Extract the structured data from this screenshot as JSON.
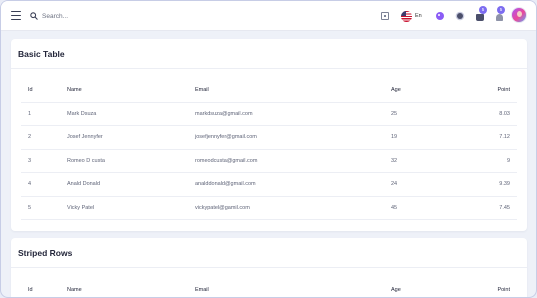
{
  "header": {
    "search_placeholder": "Search...",
    "language": "En",
    "cart_count": "5",
    "notification_count": "5"
  },
  "basic_table": {
    "title": "Basic Table",
    "columns": [
      "Id",
      "Name",
      "Email",
      "Age",
      "Point"
    ],
    "rows": [
      {
        "id": "1",
        "name": "Mark Dsuza",
        "email": "markdsuza@gmail.com",
        "age": "25",
        "point": "8.03"
      },
      {
        "id": "2",
        "name": "Josef Jennyfer",
        "email": "josefjennyfer@gmail.com",
        "age": "19",
        "point": "7.12"
      },
      {
        "id": "3",
        "name": "Romeo D custa",
        "email": "romeodcusta@gmail.com",
        "age": "32",
        "point": "9"
      },
      {
        "id": "4",
        "name": "Anald Donald",
        "email": "analddonald@gmail.com",
        "age": "24",
        "point": "9.39"
      },
      {
        "id": "5",
        "name": "Vicky Patel",
        "email": "vickypatel@gamil.com",
        "age": "45",
        "point": "7.45"
      }
    ]
  },
  "striped_table": {
    "title": "Striped Rows",
    "columns": [
      "Id",
      "Name",
      "Email",
      "Age",
      "Point"
    ]
  },
  "colors": {
    "accent": "#7c6cf0",
    "background": "#eef1f8"
  }
}
